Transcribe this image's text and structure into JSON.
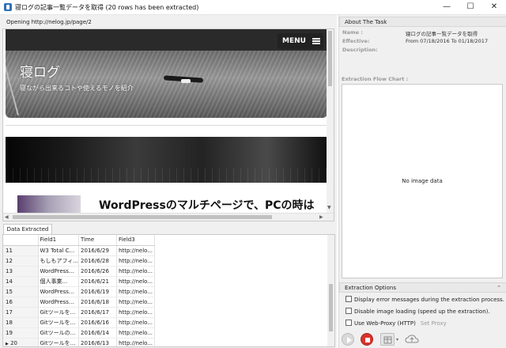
{
  "window": {
    "title": "寝ログの記事一覧データを取得 (20 rows has been extracted)",
    "minimize_glyph": "—",
    "maximize_glyph": "☐",
    "close_glyph": "✕"
  },
  "browser": {
    "opening_label": "Opening http://nelog.jp/page/2",
    "menu_label": "MENU",
    "site_title": "寝ログ",
    "site_subtitle": "寝ながら出来るコトや使えるモノを紹介",
    "article_title": "WordPressのマルチページで、PCの時は"
  },
  "data_tab": {
    "label": "Data Extracted"
  },
  "grid": {
    "columns": [
      "",
      "Field1",
      "Time",
      "Field3"
    ],
    "rows": [
      {
        "num": "11",
        "field1": "W3 Total C...",
        "time": "2016/6/29",
        "field3": "http://nelo..."
      },
      {
        "num": "12",
        "field1": "もしもアフィ...",
        "time": "2016/6/28",
        "field3": "http://nelo..."
      },
      {
        "num": "13",
        "field1": "WordPress...",
        "time": "2016/6/26",
        "field3": "http://nelo..."
      },
      {
        "num": "14",
        "field1": "個人事業...",
        "time": "2016/6/21",
        "field3": "http://nelo..."
      },
      {
        "num": "15",
        "field1": "WordPress...",
        "time": "2016/6/19",
        "field3": "http://nelo..."
      },
      {
        "num": "16",
        "field1": "WordPress...",
        "time": "2016/6/18",
        "field3": "http://nelo..."
      },
      {
        "num": "17",
        "field1": "Gitツールを...",
        "time": "2016/6/17",
        "field3": "http://nelo..."
      },
      {
        "num": "18",
        "field1": "Gitツールを...",
        "time": "2016/6/16",
        "field3": "http://nelo..."
      },
      {
        "num": "19",
        "field1": "Gitツールの...",
        "time": "2016/6/14",
        "field3": "http://nelo..."
      },
      {
        "num": "20",
        "field1": "Gitツールを...",
        "time": "2016/6/13",
        "field3": "http://nelo..."
      }
    ],
    "current_row_marker": "▶"
  },
  "about": {
    "header": "About The Task",
    "name_label": "Name :",
    "name_value": "寝ログの記事一覧データを取得",
    "effective_label": "Effective:",
    "effective_value": "From 07/18/2016 To 01/18/2017",
    "description_label": "Description:",
    "flow_label": "Extraction Flow Chart :",
    "no_image": "No image data"
  },
  "options": {
    "header": "Extraction Options",
    "opt1": "Display error messages during the extraction process.",
    "opt2": "Disable image loading (speed up the extraction).",
    "opt3": "Use Web-Proxy (HTTP)",
    "set_proxy": "Set Proxy"
  },
  "colors": {
    "accent_blue": "#2f6fb5",
    "stop_red": "#d9332b",
    "pane_bg": "#f0f0f0"
  }
}
